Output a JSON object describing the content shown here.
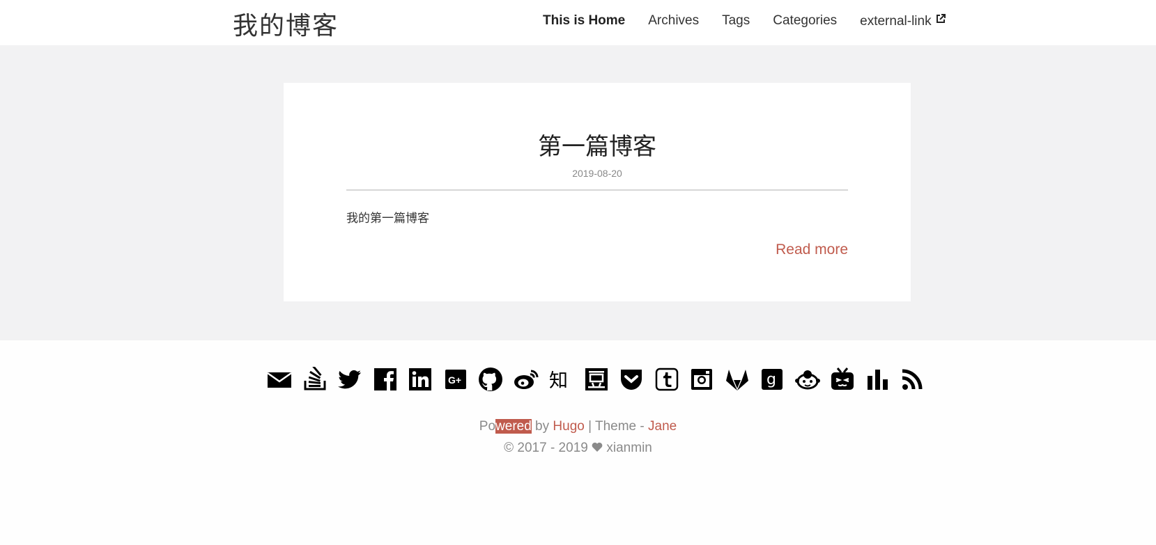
{
  "site": {
    "logo": "我的博客"
  },
  "nav": {
    "items": [
      {
        "label": "This is Home"
      },
      {
        "label": "Archives"
      },
      {
        "label": "Tags"
      },
      {
        "label": "Categories"
      },
      {
        "label": "external-link"
      }
    ]
  },
  "post": {
    "title": "第一篇博客",
    "date": "2019-08-20",
    "summary": "我的第一篇博客",
    "read_more": "Read more"
  },
  "social": {
    "icons": [
      "email-icon",
      "stackoverflow-icon",
      "twitter-icon",
      "facebook-icon",
      "linkedin-icon",
      "google-plus-icon",
      "github-icon",
      "weibo-icon",
      "zhihu-icon",
      "douban-icon",
      "pocket-icon",
      "tumblr-icon",
      "instagram-icon",
      "gitlab-icon",
      "goodreads-icon",
      "coolapk-icon",
      "bilibili-icon",
      "stats-icon",
      "rss-icon"
    ]
  },
  "footer": {
    "powered_prefix": "Po",
    "powered_highlight": "wered",
    "powered_by": " by ",
    "hugo": "Hugo",
    "theme_sep": " | Theme - ",
    "jane": "Jane",
    "copyright_years": "© 2017 - 2019",
    "author": "xianmin"
  },
  "colors": {
    "accent": "#c05b4d",
    "main_bg": "#f2f2f3"
  }
}
